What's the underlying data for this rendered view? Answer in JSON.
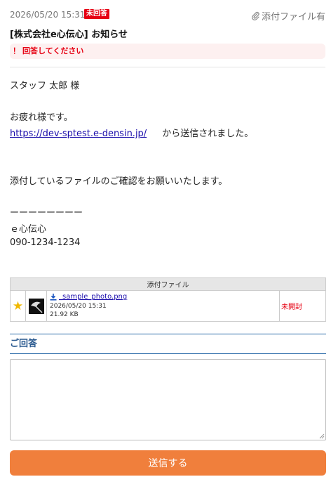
{
  "message": {
    "date": "2026/05/20 15:31",
    "status_badge": "未回答",
    "attachment_flag": "添付ファイル有",
    "subject": "[株式会社e心伝心] お知らせ",
    "alert_mark": "！",
    "alert_text": "回答してください",
    "body": {
      "greeting": "スタッフ 太郎 様",
      "line1": "お疲れ様です。",
      "link": "https://dev-sptest.e-densin.jp/",
      "link_suffix": "から送信されました。",
      "line2": "添付しているファイルのご確認をお願いいたします。",
      "separator": "ーーーーーーーー",
      "sig_name": "ｅ心伝心",
      "sig_phone": "090-1234-1234"
    }
  },
  "attachments": {
    "header": "添付ファイル",
    "files": [
      {
        "name": "_sample_photo.png",
        "date": "2026/05/20 15:31",
        "size": "21.92 KB",
        "status": "未開封",
        "starred": true
      }
    ]
  },
  "answer": {
    "title": "ご回答",
    "textarea_value": "",
    "submit_label": "送信する"
  },
  "colors": {
    "accent_orange": "#f07f3c",
    "alert_red": "#e60012",
    "link_blue": "#1a0dab",
    "section_blue": "#2a5a90",
    "star_gold": "#f0b800"
  }
}
